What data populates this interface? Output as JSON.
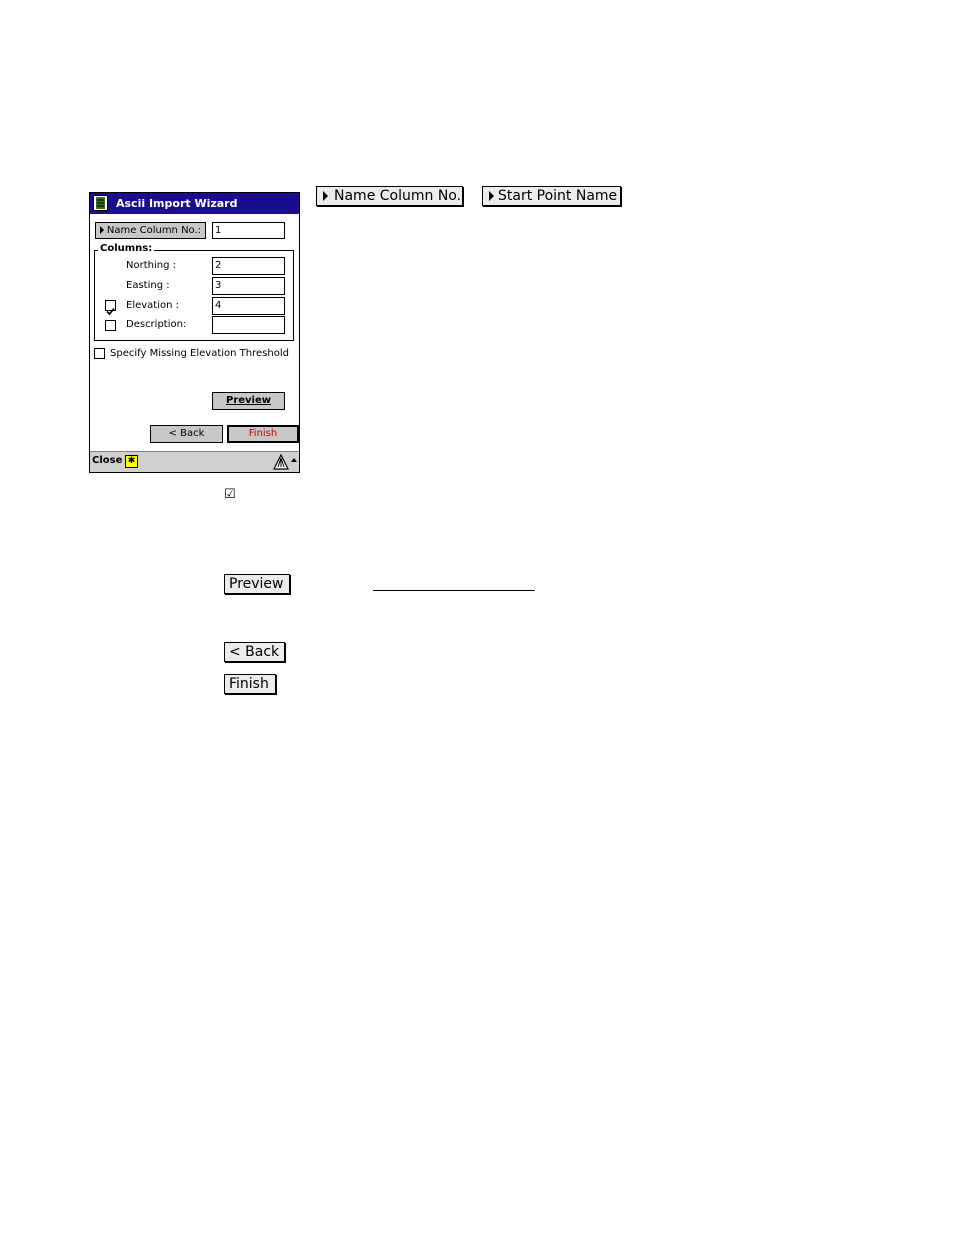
{
  "window": {
    "title": "Ascii Import Wizard",
    "name_column_button": "Name Column No.:",
    "name_column_value": "1",
    "columns_label": "Columns:",
    "fields": [
      {
        "label": "Northing :",
        "value": "2",
        "checkbox": false
      },
      {
        "label": "Easting :",
        "value": "3",
        "checkbox": false
      },
      {
        "label": "Elevation :",
        "value": "4",
        "checkbox": true,
        "checked": true
      },
      {
        "label": "Description:",
        "value": "",
        "checkbox": true,
        "checked": false
      }
    ],
    "missing_elevation_label": "Specify Missing Elevation Threshold",
    "missing_elevation_checked": false,
    "preview_label": "Preview",
    "back_label": "< Back",
    "finish_label": "Finish",
    "taskbar": {
      "close_label": "Close"
    }
  },
  "reference_buttons": {
    "name_column": "Name Column No.",
    "start_point": "Start Point Name",
    "preview": "Preview",
    "back": "< Back",
    "finish": "Finish",
    "checkbox_glyph": "☑"
  },
  "colors": {
    "titlebar": "#1a0e8e",
    "finish_text": "#cc0000",
    "star_icon": "#ffff00"
  }
}
